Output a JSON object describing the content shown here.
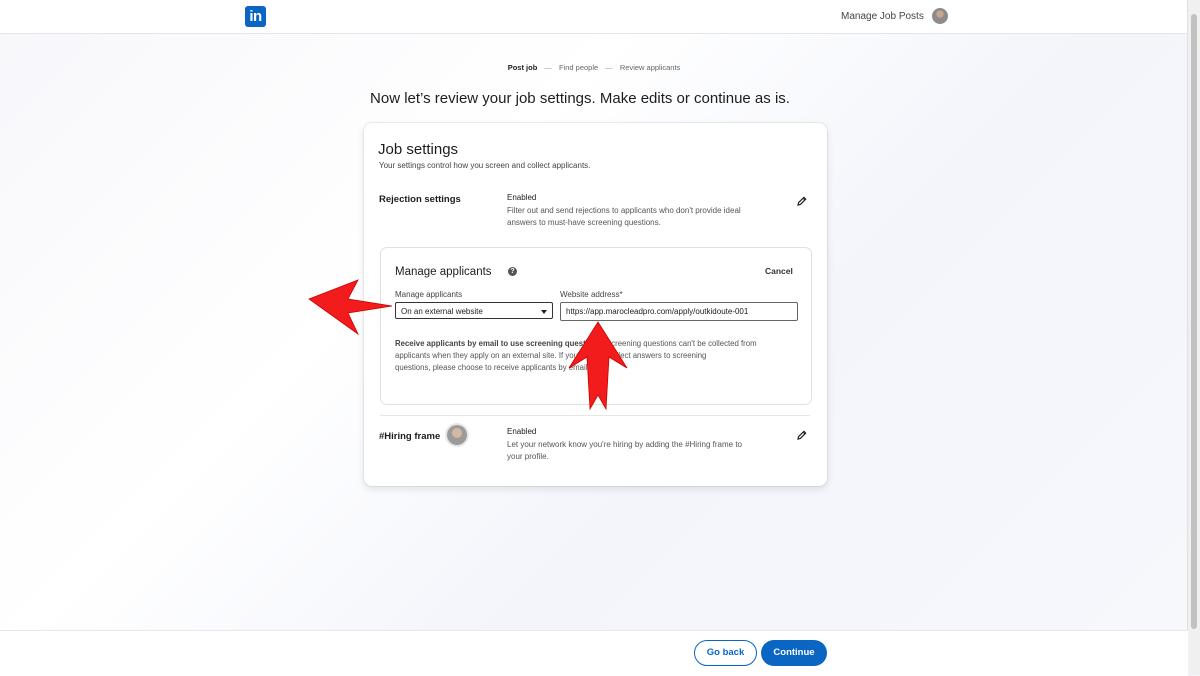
{
  "header": {
    "logo_text": "in",
    "manage_link": "Manage Job Posts"
  },
  "steps": [
    "Post job",
    "Find people",
    "Review applicants"
  ],
  "heading": "Now let’s review your job settings. Make edits or continue as is.",
  "job_settings": {
    "title": "Job settings",
    "subtitle": "Your settings control how you screen and collect applicants.",
    "rejection": {
      "label": "Rejection settings",
      "status": "Enabled",
      "description_line1": "Filter out and send rejections to applicants who don't provide ideal",
      "description_line2": "answers to must-have screening questions."
    },
    "manage_applicants": {
      "title": "Manage applicants",
      "cancel_label": "Cancel",
      "select_label": "Manage applicants",
      "select_value": "On an external website",
      "website_label": "Website address*",
      "website_value": "https://app.marocleadpro.com/apply/outkidoute-001",
      "notice_bold": "Receive applicants by email to use screening questions.",
      "notice_line1_rest": " Screening questions can't be collected from",
      "notice_line2": "applicants when they apply on an external site. If you'd like to collect answers to screening",
      "notice_line3": "questions, please choose to receive applicants by email."
    },
    "hiring_frame": {
      "label": "#Hiring frame",
      "status": "Enabled",
      "description_line1": "Let your network know you're hiring by adding the #Hiring frame to",
      "description_line2": "your profile."
    }
  },
  "footer": {
    "back_label": "Go back",
    "continue_label": "Continue"
  },
  "colors": {
    "brand": "#0a66c2",
    "annotation_arrow": "#f21c1c"
  }
}
